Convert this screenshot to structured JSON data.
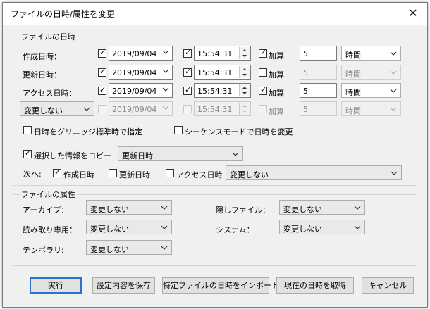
{
  "window": {
    "title": "ファイルの日時/属性を変更",
    "close_glyph": "✕"
  },
  "datetime_group": {
    "title": "ファイルの日時",
    "rows": [
      {
        "label": "作成日時：",
        "date_checked": true,
        "date": "2019/09/04",
        "time_checked": true,
        "time": "15:54:31",
        "add_checked": true,
        "add_label": "加算",
        "amount": "5",
        "unit": "時間"
      },
      {
        "label": "更新日時：",
        "date_checked": true,
        "date": "2019/09/04",
        "time_checked": true,
        "time": "15:54:31",
        "add_checked": false,
        "add_label": "加算",
        "amount": "5",
        "unit": "時間"
      },
      {
        "label": "アクセス日時：",
        "date_checked": true,
        "date": "2019/09/04",
        "time_checked": true,
        "time": "15:54:31",
        "add_checked": true,
        "add_label": "加算",
        "amount": "5",
        "unit": "時間"
      },
      {
        "label": "変更しない",
        "date_checked": false,
        "date": "2019/09/04",
        "time_checked": false,
        "time": "15:54:31",
        "add_checked": false,
        "add_label": "加算",
        "amount": "5",
        "unit": "時間"
      }
    ],
    "greenwich_label": "日時をグリニッジ標準時で指定",
    "sequence_label": "シーケンスモードで日時を変更",
    "copy_label": "選択した情報をコピー",
    "copy_source": "更新日時",
    "next_label": "次へ:",
    "next_created": "作成日時",
    "next_modified": "更新日時",
    "next_accessed": "アクセス日時",
    "next_action": "変更しない"
  },
  "attr_group": {
    "title": "ファイルの属性",
    "archive_label": "アーカイブ：",
    "archive_value": "変更しない",
    "hidden_label": "隠しファイル：",
    "hidden_value": "変更しない",
    "readonly_label": "読み取り専用：",
    "readonly_value": "変更しない",
    "system_label": "システム：",
    "system_value": "変更しない",
    "temp_label": "テンポラリ:",
    "temp_value": "変更しない"
  },
  "buttons": {
    "run": "実行",
    "save": "設定内容を保存",
    "import": "特定ファイルの日時をインポート",
    "now": "現在の日時を取得",
    "cancel": "キャンセル"
  }
}
